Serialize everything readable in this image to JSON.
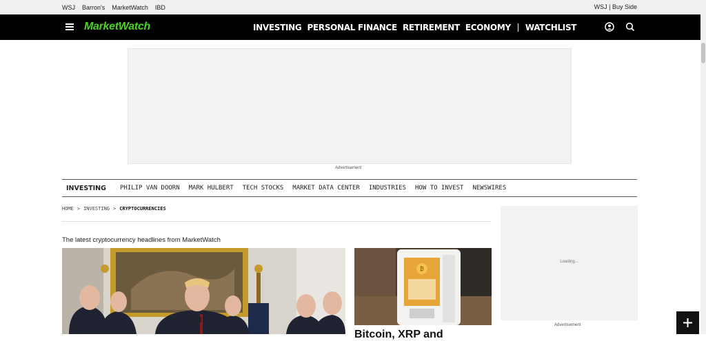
{
  "topbar": {
    "links": [
      "WSJ",
      "Barron's",
      "MarketWatch",
      "IBD"
    ],
    "right": "WSJ | Buy Side"
  },
  "header": {
    "logo": "MarketWatch",
    "nav": [
      "INVESTING",
      "PERSONAL FINANCE",
      "RETIREMENT",
      "ECONOMY"
    ],
    "watchlist": "WATCHLIST"
  },
  "ad": {
    "label": "Advertisement",
    "side_loading": "Loading...",
    "side_label": "Advertisement"
  },
  "subnav": {
    "active": "INVESTING",
    "items": [
      "PHILIP VAN DOORN",
      "MARK HULBERT",
      "TECH STOCKS",
      "MARKET DATA CENTER",
      "INDUSTRIES",
      "HOW TO INVEST",
      "NEWSWIRES"
    ]
  },
  "breadcrumb": {
    "home": "HOME",
    "sep": ">",
    "section": "INVESTING",
    "current": "CRYPTOCURRENCIES"
  },
  "main": {
    "intro": "The latest cryptocurrency headlines from MarketWatch",
    "second_story_title": "Bitcoin, XRP and"
  },
  "colors": {
    "brand_green": "#4bd325",
    "nav_bg": "#000000",
    "topbar_bg": "#eef0f2"
  }
}
